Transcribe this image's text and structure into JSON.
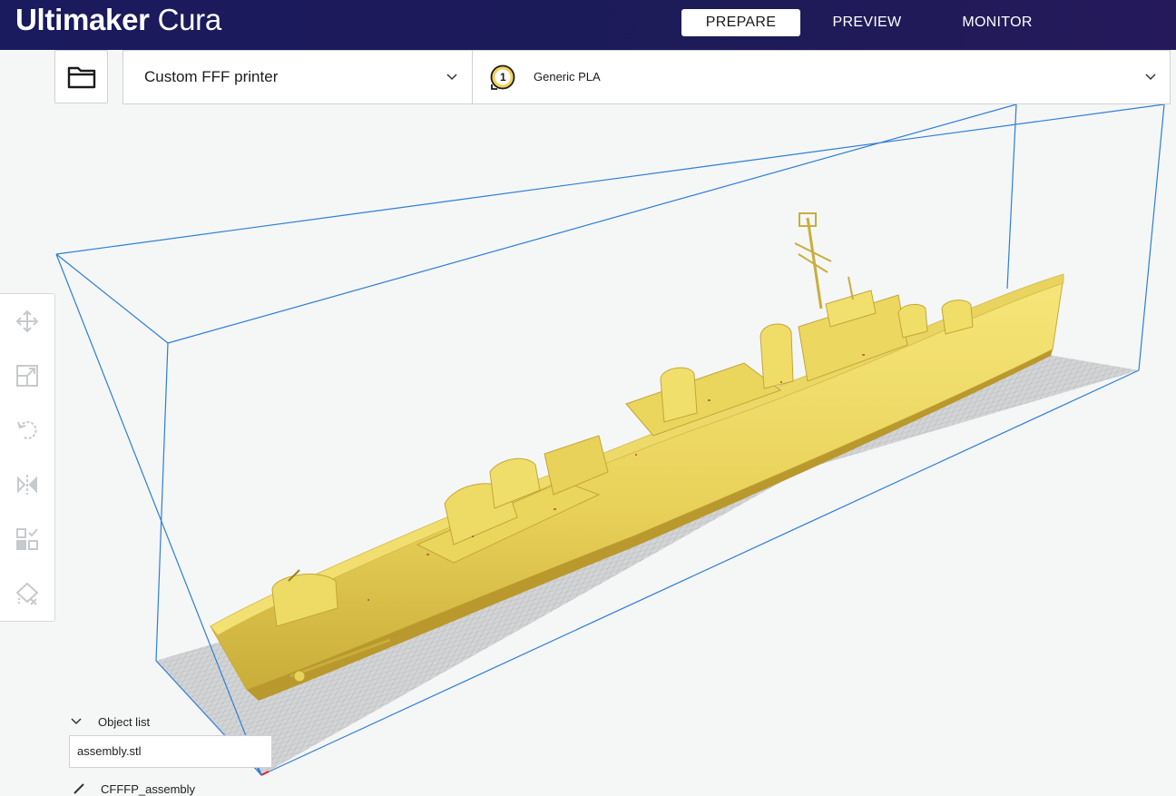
{
  "app": {
    "logo_bold": "Ultimaker",
    "logo_light": "Cura"
  },
  "tabs": [
    {
      "label": "PREPARE",
      "active": true
    },
    {
      "label": "PREVIEW",
      "active": false
    },
    {
      "label": "MONITOR",
      "active": false
    }
  ],
  "printer": {
    "name": "Custom FFF printer"
  },
  "material": {
    "extruder_number": "1",
    "name": "Generic PLA"
  },
  "tools": [
    {
      "icon": "move-icon"
    },
    {
      "icon": "scale-icon"
    },
    {
      "icon": "rotate-icon"
    },
    {
      "icon": "mirror-icon"
    },
    {
      "icon": "per-model-settings-icon"
    },
    {
      "icon": "support-blocker-icon"
    }
  ],
  "object_list": {
    "label": "Object list",
    "items": [
      "assembly.stl"
    ]
  },
  "job": {
    "name": "CFFFP_assembly"
  },
  "colors": {
    "header": "#1a1a5e",
    "build_volume_edge": "#2c7fd6",
    "model": "#f1df6a",
    "plate_grid": "#b9babc"
  }
}
